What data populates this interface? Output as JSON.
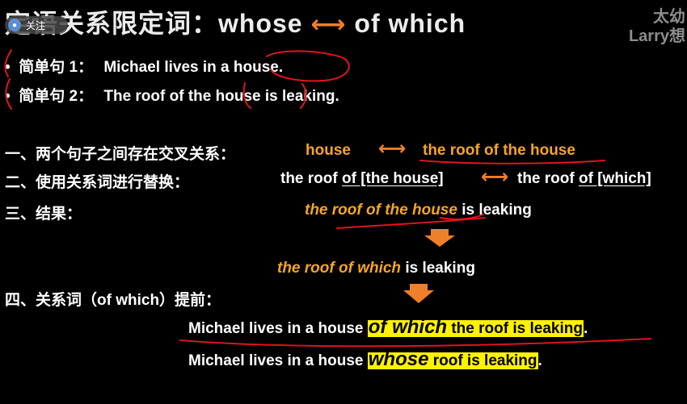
{
  "title": {
    "prefix": "定语关系限定词：whose",
    "arrow": "⟷",
    "suffix": "of which"
  },
  "watermark": {
    "line1": "太幼",
    "line2": "Larry想"
  },
  "follow_button": {
    "label": "关注"
  },
  "sentences": [
    {
      "label": "简单句 1：",
      "text_before": "Michael lives in a ",
      "highlight": "house",
      "text_after": "."
    },
    {
      "label": "简单句 2：",
      "text_before": "The roof of the ",
      "highlight": "house",
      "text_after": " is leaking."
    }
  ],
  "step1": {
    "label": "一、两个句子之间存在交叉关系：",
    "left": "house",
    "arrow": "⟷",
    "right": "the roof of the house"
  },
  "step2": {
    "label": "二、使用关系词进行替换：",
    "left_plain": "the roof ",
    "left_u": "of [the house]",
    "arrow": "⟷",
    "right_plain": "the roof ",
    "right_u": "of [which]"
  },
  "step3": {
    "label": "三、结果：",
    "phrase1": "the roof of the house",
    "rest1": " is leaking",
    "phrase2": "the roof of which",
    "rest2": " is leaking"
  },
  "step4": {
    "label": "四、关系词（of which）提前：",
    "line1": {
      "before": "Michael lives in a house ",
      "emph": "of which",
      "hl_rest": " the roof is leaking",
      "end": "."
    },
    "line2": {
      "before": "Michael lives in a house ",
      "emph": "whose",
      "hl_rest": " roof is leaking",
      "end": "."
    }
  },
  "colors": {
    "accent": "#f5a623",
    "arrow": "#f07f2a",
    "highlight": "#fff200",
    "ink": "#e0141e"
  }
}
